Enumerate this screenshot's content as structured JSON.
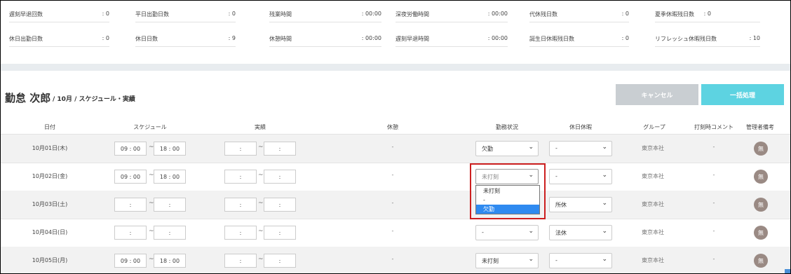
{
  "summary": {
    "row1": [
      {
        "label": "遅刻早退回数",
        "value": ": 0"
      },
      {
        "label": "平日出勤日数",
        "value": ": 0"
      },
      {
        "label": "残業時間",
        "value": ": 00:00"
      },
      {
        "label": "深夜労働時間",
        "value": ": 00:00"
      },
      {
        "label": "代休残日数",
        "value": ": 0"
      },
      {
        "label": "夏季休暇残日数",
        "value": ": 0"
      }
    ],
    "row2": [
      {
        "label": "休日出勤日数",
        "value": ": 0"
      },
      {
        "label": "休日日数",
        "value": ": 9"
      },
      {
        "label": "休憩時間",
        "value": ": 00:00"
      },
      {
        "label": "遅刻早退時間",
        "value": ": 00:00"
      },
      {
        "label": "誕生日休暇残日数",
        "value": ": 0"
      },
      {
        "label": "リフレッシュ休暇残日数",
        "value": ": 10"
      }
    ]
  },
  "header": {
    "employee_name": "勤怠 次郎",
    "breadcrumb": "/ 10月 / スケジュール・実績",
    "cancel_label": "キャンセル",
    "bulk_label": "一括処理"
  },
  "columns": {
    "date": "日付",
    "schedule": "スケジュール",
    "actual": "実績",
    "break": "休憩",
    "status": "勤務状況",
    "holiday": "休日休暇",
    "group": "グループ",
    "comment": "打刻時コメント",
    "admin_note": "管理者備考"
  },
  "rows": [
    {
      "date": "10月01日(木)",
      "sched": [
        "09 : 00",
        "18 : 00"
      ],
      "actual": [
        ":",
        ":"
      ],
      "break": "-",
      "status": "欠勤",
      "holiday": "-",
      "group": "東京本社",
      "comment": "-",
      "note": "無"
    },
    {
      "date": "10月02日(金)",
      "sched": [
        "09 : 00",
        "18 : 00"
      ],
      "actual": [
        ":",
        ":"
      ],
      "break": "-",
      "status": "未打刻",
      "holiday": "-",
      "group": "東京本社",
      "comment": "-",
      "note": "無"
    },
    {
      "date": "10月03日(土)",
      "sched": [
        ":",
        ":"
      ],
      "actual": [
        ":",
        ":"
      ],
      "break": "-",
      "status": "",
      "holiday": "所休",
      "group": "東京本社",
      "comment": "-",
      "note": "無"
    },
    {
      "date": "10月04日(日)",
      "sched": [
        ":",
        ":"
      ],
      "actual": [
        ":",
        ":"
      ],
      "break": "-",
      "status": "-",
      "holiday": "法休",
      "group": "東京本社",
      "comment": "-",
      "note": "無"
    },
    {
      "date": "10月05日(月)",
      "sched": [
        "09 : 00",
        "18 : 00"
      ],
      "actual": [
        ":",
        ":"
      ],
      "break": "-",
      "status": "未打刻",
      "holiday": "-",
      "group": "東京本社",
      "comment": "-",
      "note": "無"
    }
  ],
  "dropdown": {
    "options": [
      "未打刻",
      "-",
      "欠勤"
    ],
    "selected_index": 2
  },
  "icons": {
    "select_chevron": "chevron-down-icon"
  }
}
